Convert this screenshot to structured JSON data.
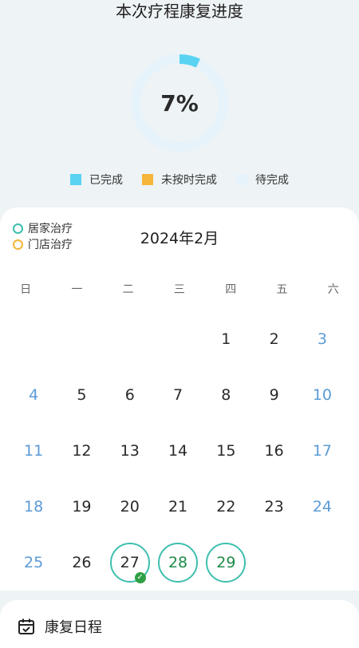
{
  "progress": {
    "title": "本次疗程康复进度",
    "percent_text": "7%",
    "percent": 7,
    "legend": [
      {
        "label": "已完成",
        "color": "#5ad3f2"
      },
      {
        "label": "未按时完成",
        "color": "#f6b63a"
      },
      {
        "label": "待完成",
        "color": "#e6f3fb"
      }
    ]
  },
  "calendar": {
    "types": [
      {
        "label": "居家治疗",
        "color": "#3ebfae"
      },
      {
        "label": "门店治疗",
        "color": "#f1b53a"
      }
    ],
    "month": "2024年2月",
    "weekdays": [
      "日",
      "一",
      "二",
      "三",
      "四",
      "五",
      "六"
    ],
    "days": [
      "",
      "",
      "",
      "",
      "1",
      "2",
      "3",
      "4",
      "5",
      "6",
      "7",
      "8",
      "9",
      "10",
      "11",
      "12",
      "13",
      "14",
      "15",
      "16",
      "17",
      "18",
      "19",
      "20",
      "21",
      "22",
      "23",
      "24",
      "25",
      "26",
      "27",
      "28",
      "29"
    ],
    "marked_days": [
      "27",
      "28",
      "29"
    ],
    "completed_days": [
      "27"
    ]
  },
  "schedule": {
    "title": "康复日程",
    "icon": "calendar-check-icon"
  }
}
